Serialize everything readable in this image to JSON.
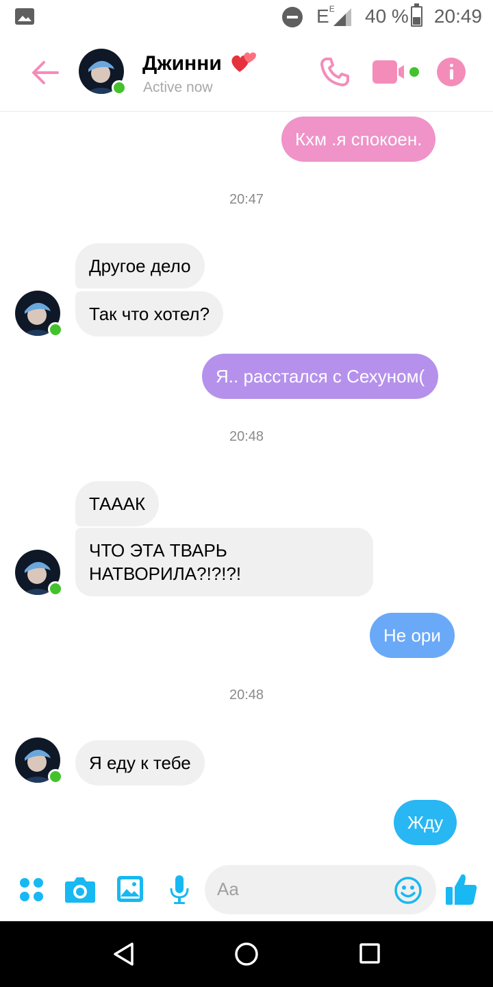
{
  "status_bar": {
    "network": "E",
    "network_sub": "E",
    "battery_percent": "40 %",
    "time": "20:49",
    "icons": [
      "gallery-icon",
      "do-not-disturb-icon",
      "signal-icon",
      "battery-icon"
    ]
  },
  "header": {
    "contact_name": "Джинни",
    "contact_status": "Active now",
    "icons": [
      "back-arrow-icon",
      "two-hearts-icon",
      "phone-icon",
      "video-camera-icon",
      "info-icon"
    ]
  },
  "messages": [
    {
      "from": "me",
      "text": "Кхм .я спокоен.",
      "color": "#ef93c8"
    },
    {
      "timestamp": "20:47"
    },
    {
      "from": "them",
      "text": "Другое дело"
    },
    {
      "from": "them",
      "text": "Так что хотел?"
    },
    {
      "from": "me",
      "text": "Я.. расстался с Сехуном(",
      "color": "#b591ec"
    },
    {
      "timestamp": "20:48"
    },
    {
      "from": "them",
      "text": "ТАААК"
    },
    {
      "from": "them",
      "text": "ЧТО ЭТА ТВАРЬ НАТВОРИЛА?!?!?!"
    },
    {
      "from": "me",
      "text": "Не ори",
      "color": "#6aa9f7"
    },
    {
      "timestamp": "20:48"
    },
    {
      "from": "them",
      "text": "Я еду к тебе"
    },
    {
      "from": "me",
      "text": "Жду",
      "color": "#28b7f2"
    }
  ],
  "composer": {
    "placeholder": "Aa",
    "icons": [
      "menu-dots-icon",
      "camera-icon",
      "image-icon",
      "microphone-icon",
      "emoji-icon",
      "thumbs-up-icon"
    ]
  },
  "colors": {
    "accent_pink": "#f48cba",
    "composer_blue": "#18b8f2",
    "online_green": "#44c22b",
    "incoming_bubble": "#f1f0f0"
  }
}
